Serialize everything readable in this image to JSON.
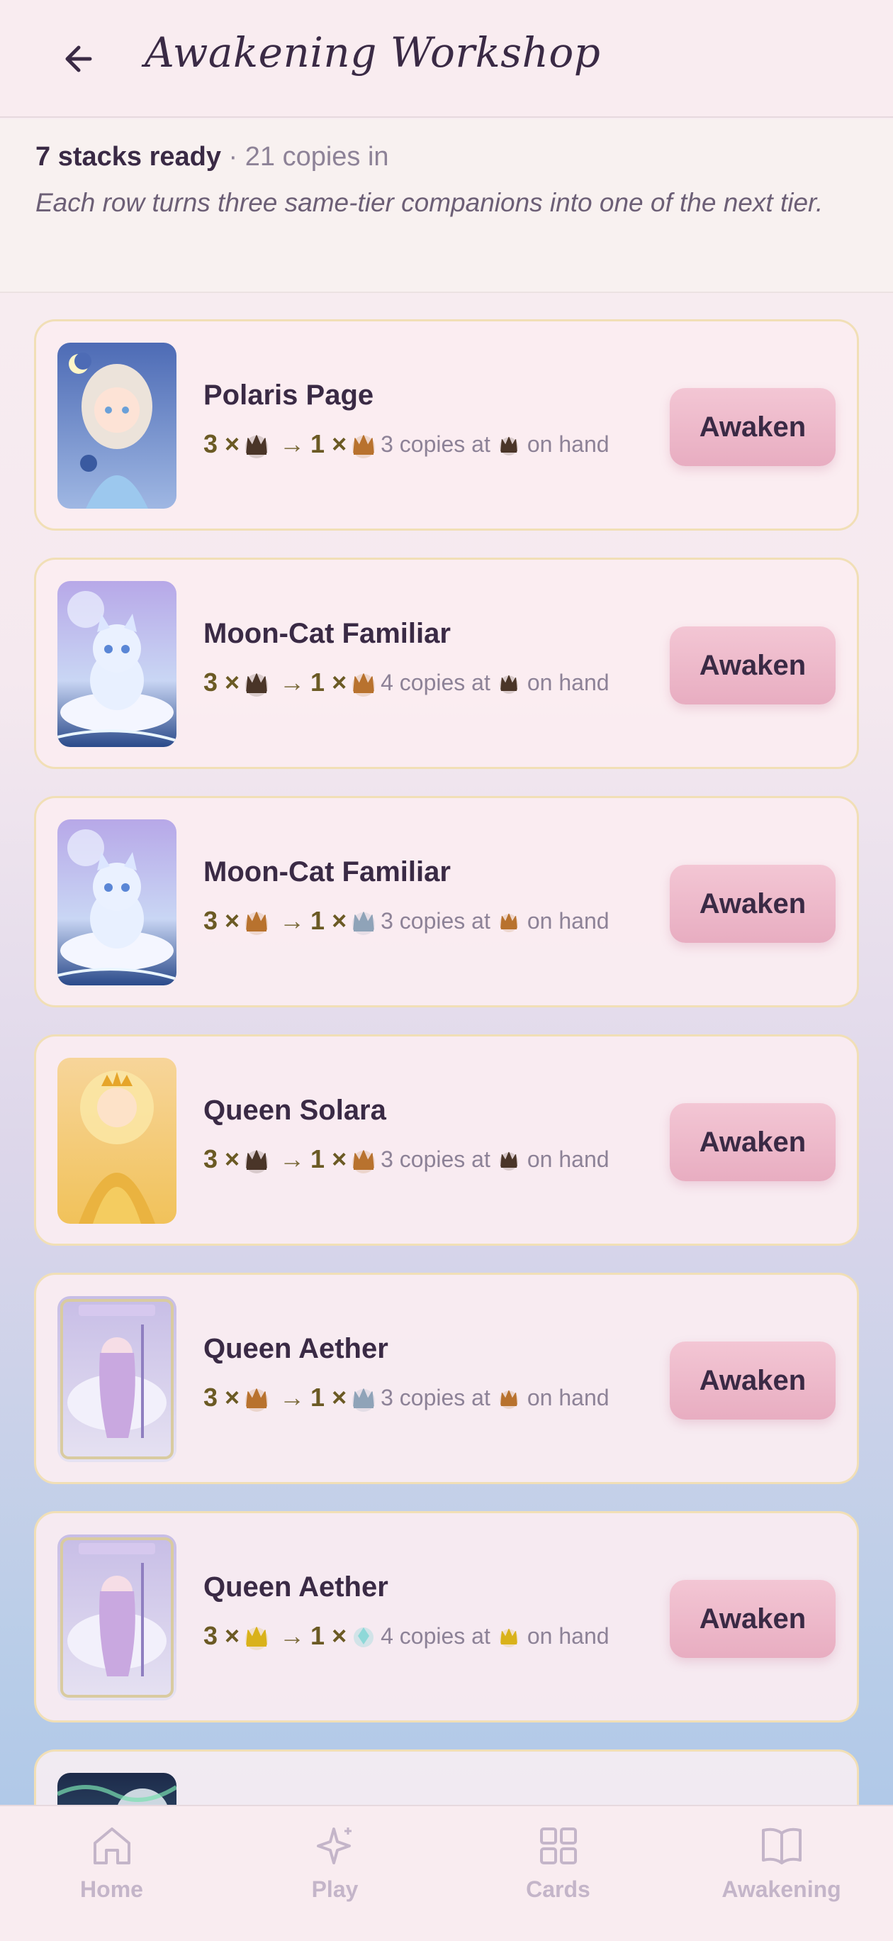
{
  "header": {
    "title": "Awakening Workshop",
    "back_icon": "arrow-left-icon"
  },
  "summary": {
    "stacks": "7 stacks ready",
    "copies": "· 21 copies in",
    "description": "Each row turns three same-tier companions into one of the next tier."
  },
  "tier_colors": {
    "dark": "#4a3528",
    "bronze": "#b8722e",
    "silver": "#8fa3b8",
    "gold": "#d9b21a",
    "crystal": "#8ed8d8"
  },
  "cards": [
    {
      "name": "Polaris Page",
      "in_count": "3 ×",
      "out_count": "1 ×",
      "arrow": "→",
      "from_tier": "dark",
      "to_tier": "bronze",
      "copies": "3 copies at",
      "on_hand": "on hand",
      "button": "Awaken",
      "art": "polaris"
    },
    {
      "name": "Moon-Cat Familiar",
      "in_count": "3 ×",
      "out_count": "1 ×",
      "arrow": "→",
      "from_tier": "dark",
      "to_tier": "bronze",
      "copies": "4 copies at",
      "on_hand": "on hand",
      "button": "Awaken",
      "art": "mooncat"
    },
    {
      "name": "Moon-Cat Familiar",
      "in_count": "3 ×",
      "out_count": "1 ×",
      "arrow": "→",
      "from_tier": "bronze",
      "to_tier": "silver",
      "copies": "3 copies at",
      "on_hand": "on hand",
      "button": "Awaken",
      "art": "mooncat"
    },
    {
      "name": "Queen Solara",
      "in_count": "3 ×",
      "out_count": "1 ×",
      "arrow": "→",
      "from_tier": "dark",
      "to_tier": "bronze",
      "copies": "3 copies at",
      "on_hand": "on hand",
      "button": "Awaken",
      "art": "solara"
    },
    {
      "name": "Queen Aether",
      "in_count": "3 ×",
      "out_count": "1 ×",
      "arrow": "→",
      "from_tier": "bronze",
      "to_tier": "silver",
      "copies": "3 copies at",
      "on_hand": "on hand",
      "button": "Awaken",
      "art": "aether"
    },
    {
      "name": "Queen Aether",
      "in_count": "3 ×",
      "out_count": "1 ×",
      "arrow": "→",
      "from_tier": "gold",
      "to_tier": "crystal",
      "copies": "4 copies at",
      "on_hand": "on hand",
      "button": "Awaken",
      "art": "aether"
    }
  ],
  "nav": [
    {
      "label": "Home",
      "icon": "home-icon"
    },
    {
      "label": "Play",
      "icon": "sparkle-icon"
    },
    {
      "label": "Cards",
      "icon": "grid-icon"
    },
    {
      "label": "Awakening",
      "icon": "book-icon"
    }
  ]
}
